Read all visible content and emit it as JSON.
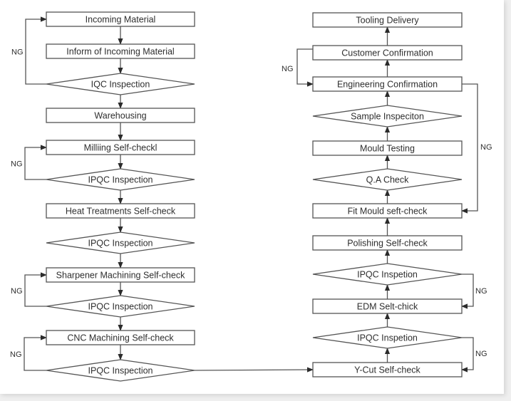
{
  "diagram": {
    "left_column": [
      {
        "id": "incoming-material",
        "type": "box",
        "label": "Incoming Material"
      },
      {
        "id": "inform-incoming-material",
        "type": "box",
        "label": "Inform of Incoming Material"
      },
      {
        "id": "iqc-inspection",
        "type": "diamond",
        "label": "IQC Inspection"
      },
      {
        "id": "warehousing",
        "type": "box",
        "label": "Warehousing"
      },
      {
        "id": "milling-self-check",
        "type": "box",
        "label": "Milliing Self-checkl"
      },
      {
        "id": "ipqc-inspection-1",
        "type": "diamond",
        "label": "IPQC Inspection"
      },
      {
        "id": "heat-treatments-self-check",
        "type": "box",
        "label": "Heat Treatments Self-check"
      },
      {
        "id": "ipqc-inspection-2",
        "type": "diamond",
        "label": "IPQC Inspection"
      },
      {
        "id": "sharpener-machining-self-check",
        "type": "box",
        "label": "Sharpener Machining Self-check"
      },
      {
        "id": "ipqc-inspection-3",
        "type": "diamond",
        "label": "IPQC Inspection"
      },
      {
        "id": "cnc-machining-self-check",
        "type": "box",
        "label": "CNC Machining Self-check"
      },
      {
        "id": "ipqc-inspection-4",
        "type": "diamond",
        "label": "IPQC Inspection"
      }
    ],
    "right_column": [
      {
        "id": "tooling-delivery",
        "type": "box",
        "label": "Tooling Delivery"
      },
      {
        "id": "customer-confirmation",
        "type": "box",
        "label": "Customer Confirmation"
      },
      {
        "id": "engineering-confirmation",
        "type": "box",
        "label": "Engineering Confirmation"
      },
      {
        "id": "sample-inspection",
        "type": "diamond",
        "label": "Sample Inspeciton"
      },
      {
        "id": "mould-testing",
        "type": "box",
        "label": "Mould Testing"
      },
      {
        "id": "qa-check",
        "type": "diamond",
        "label": "Q.A Check"
      },
      {
        "id": "fit-mould-self-check",
        "type": "box",
        "label": "Fit Mould seft-check"
      },
      {
        "id": "polishing-self-check",
        "type": "box",
        "label": "Polishing Self-check"
      },
      {
        "id": "ipqc-inspection-5",
        "type": "diamond",
        "label": "IPQC Inspetion"
      },
      {
        "id": "edm-self-check",
        "type": "box",
        "label": "EDM Selt-chick"
      },
      {
        "id": "ipqc-inspection-6",
        "type": "diamond",
        "label": "IPQC Inspetion"
      },
      {
        "id": "y-cut-self-check",
        "type": "box",
        "label": "Y-Cut Self-check"
      }
    ],
    "ng_label": "NG"
  }
}
